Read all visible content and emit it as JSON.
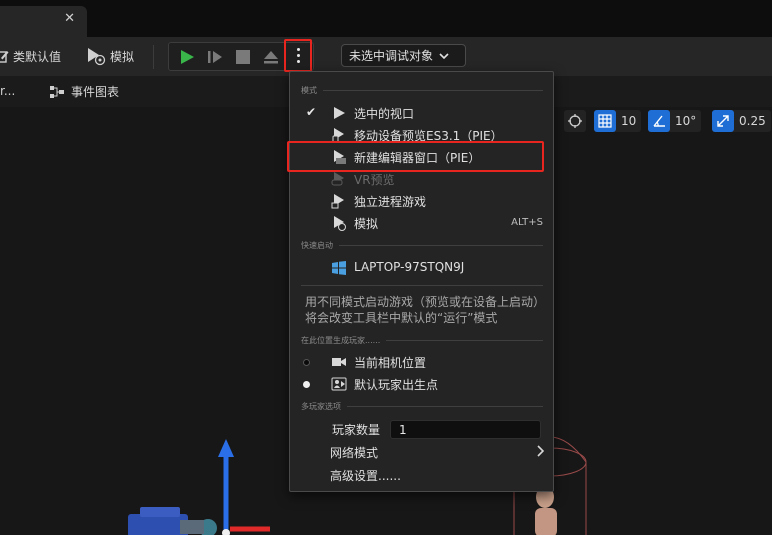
{
  "tab": {
    "close_glyph": "✕"
  },
  "toolbar": {
    "class_defaults_label": "类默认值",
    "simulate_label": "模拟",
    "debug_select_label": "未选中调试对象",
    "accent_green": "#39b54a",
    "highlight_red": "#e8261f"
  },
  "viewport_header": {
    "truncated_tab": "r...",
    "event_graph_label": "事件图表"
  },
  "viewport_tools": {
    "grid_snap_value": "10",
    "rotation_snap_value": "10°",
    "scale_snap_value": "0.25"
  },
  "menu": {
    "section_modes": "模式",
    "section_quick_launch": "快速启动",
    "section_spawn": "在此位置生成玩家......",
    "section_multiplayer": "多玩家选项",
    "items": {
      "selected_viewport": "选中的视口",
      "mobile_preview": "移动设备预览ES3.1（PIE）",
      "new_editor_window": "新建编辑器窗口（PIE）",
      "vr_preview": "VR预览",
      "standalone_game": "独立进程游戏",
      "simulate": "模拟",
      "simulate_shortcut": "ALT+S",
      "laptop_device": "LAPTOP-97STQN9J",
      "current_camera": "当前相机位置",
      "default_player_start": "默认玩家出生点",
      "player_count_label": "玩家数量",
      "player_count_value": "1",
      "net_mode": "网络模式",
      "advanced_settings": "高级设置......"
    },
    "hint_text": "用不同模式启动游戏（预览或在设备上启动）将会改变工具栏中默认的“运行”模式"
  }
}
